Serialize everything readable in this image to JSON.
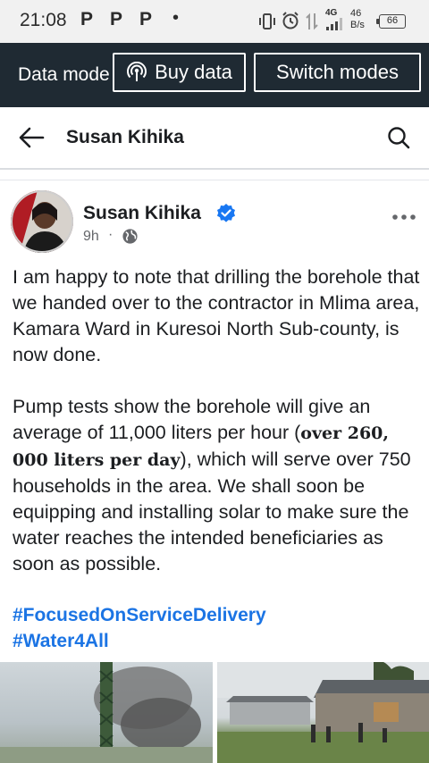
{
  "status_bar": {
    "time": "21:08",
    "notif_icons": [
      "P",
      "P",
      "P"
    ],
    "dot": "•",
    "network": "4G",
    "speed_value": "46",
    "speed_unit": "B/s",
    "battery": "66"
  },
  "data_mode": {
    "label": "Data mode",
    "buy_label": "Buy data",
    "switch_label": "Switch modes"
  },
  "header": {
    "title": "Susan Kihika"
  },
  "post": {
    "author": "Susan Kihika",
    "time": "9h",
    "separator": "·",
    "paragraph1": "I am happy to note that drilling the borehole that we handed over to the contractor in Mlima area, Kamara Ward in Kuresoi North Sub-county, is now done.",
    "paragraph2_start": "Pump tests show the borehole will give an average of 11,000 liters per hour (",
    "paragraph2_bold": "over 260, 000 liters per day",
    "paragraph2_end": "), which will serve over 750 households in the area. We shall soon be equipping and installing solar to make sure the water reaches the intended beneficiaries as soon as possible.",
    "hashtag1": "#FocusedOnServiceDelivery",
    "hashtag2": "#Water4All"
  },
  "colors": {
    "data_bar": "#1f2a33",
    "link_blue": "#1b74e4",
    "verified_blue": "#1877f2"
  },
  "icons": [
    "back-arrow-icon",
    "search-icon",
    "verified-icon",
    "globe-icon",
    "more-options-icon",
    "broadcast-icon",
    "vibrate-icon",
    "alarm-icon",
    "signal-icon"
  ]
}
